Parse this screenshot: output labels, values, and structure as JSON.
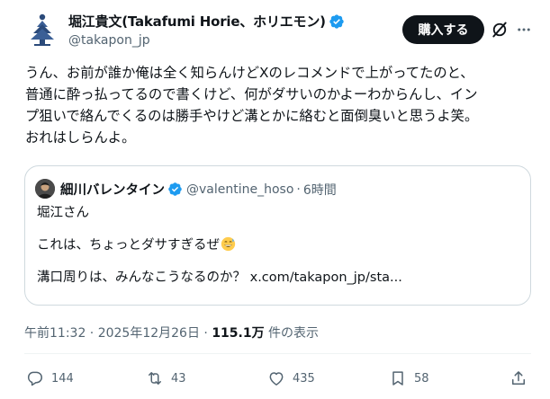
{
  "author": {
    "display_name": "堀江貴文(Takafumi Horie、ホリエモン)",
    "handle": "@takapon_jp"
  },
  "buy_button_label": "購入する",
  "icons": {
    "verified": "verified-badge-icon",
    "grok": "grok-icon",
    "more": "more-icon",
    "reply": "reply-icon",
    "repost": "repost-icon",
    "like": "like-icon",
    "bookmark": "bookmark-icon",
    "share": "share-icon"
  },
  "colors": {
    "verified_blue": "#1d9bf0",
    "button_bg": "#0f1419",
    "muted_text": "#536471",
    "border": "#cfd9de"
  },
  "post": {
    "text_lines": [
      "うん、お前が誰か俺は全く知らんけどXのレコメンドで上がってたのと、",
      "普通に酔っ払ってるので書くけど、何がダサいのかよーわからんし、イン",
      "プ狙いで絡んでくるのは勝手やけど溝とかに絡むと面倒臭いと思うよ笑。",
      "おれはしらんよ。"
    ]
  },
  "quote": {
    "display_name": "細川バレンタイン",
    "handle": "@valentine_hoso",
    "separator": "·",
    "time": "6時間",
    "lines": [
      "堀江さん",
      "これは、ちょっとダサすぎるぜ",
      "溝口周りは、みんなこうなるのか？ x.com/takapon_jp/sta..."
    ],
    "emoji": "grinning-sweat-emoji"
  },
  "meta": {
    "timestamp": "午前11:32 · 2025年12月26日 · ",
    "views_count": "115.1万",
    "views_label": " 件の表示"
  },
  "actions": {
    "reply_count": "144",
    "repost_count": "43",
    "like_count": "435",
    "bookmark_count": "58"
  }
}
